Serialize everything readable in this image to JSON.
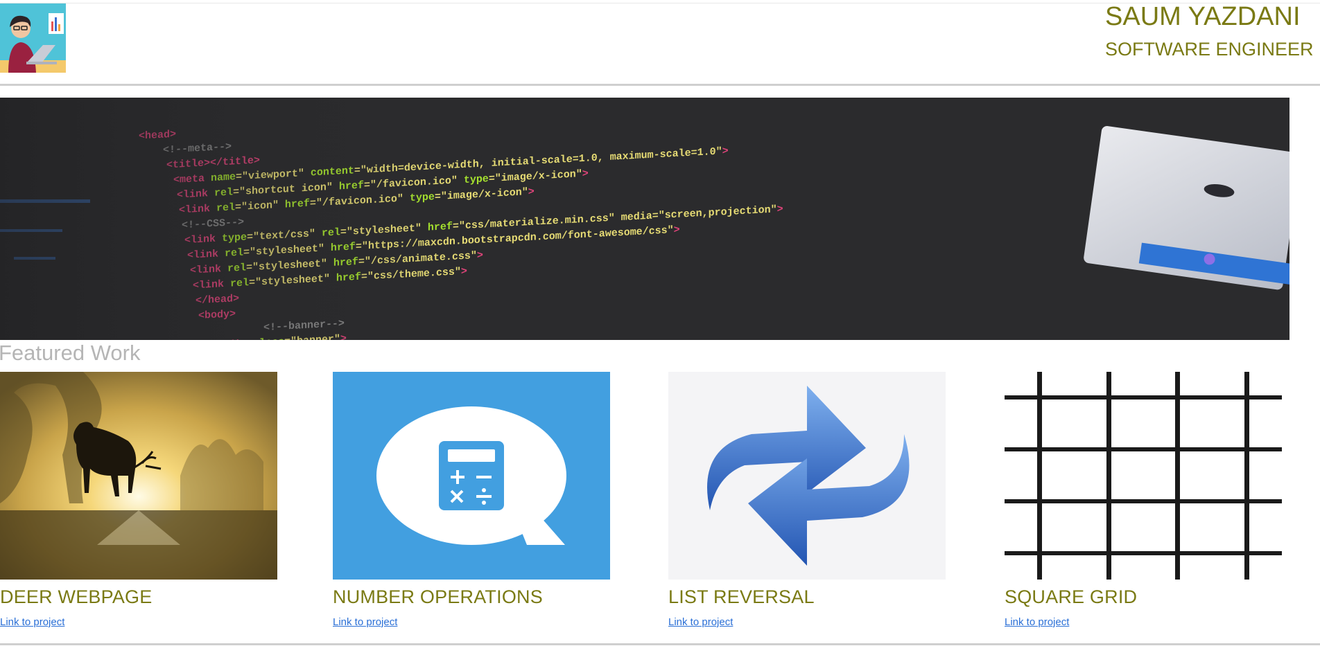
{
  "header": {
    "name": "SAUM YAZDANI",
    "role": "SOFTWARE ENGINEER"
  },
  "section_title": "Featured Work",
  "projects": [
    {
      "title": "DEER WEBPAGE",
      "link": "Link to project",
      "icon": "deer-sunset-image"
    },
    {
      "title": "NUMBER OPERATIONS",
      "link": "Link to project",
      "icon": "calculator-chat-bubble-image"
    },
    {
      "title": "LIST REVERSAL",
      "link": "Link to project",
      "icon": "reverse-arrows-image"
    },
    {
      "title": "SQUARE GRID",
      "link": "Link to project",
      "icon": "grid-image"
    }
  ],
  "colors": {
    "accent": "#7a7a14",
    "link": "#2a6fd6",
    "muted": "#b5b5b5"
  }
}
